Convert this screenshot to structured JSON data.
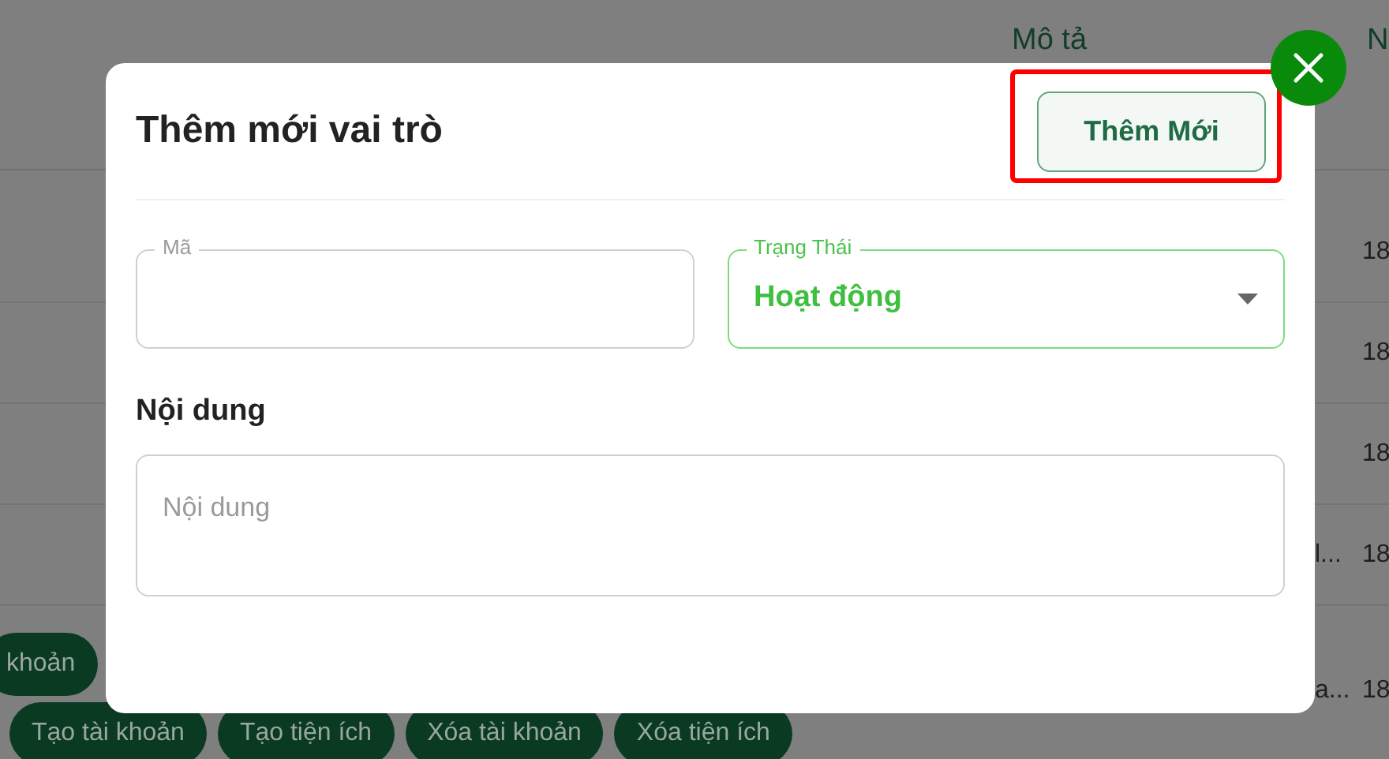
{
  "background_table": {
    "columns": [
      {
        "label": "Mô tả"
      },
      {
        "label": "N"
      }
    ],
    "rows": [
      {
        "column_1": "",
        "column_2": "18"
      },
      {
        "column_1": "",
        "column_2": "18"
      },
      {
        "column_1": "",
        "column_2": "18"
      },
      {
        "column_1": "l...",
        "column_2": "18"
      },
      {
        "column_1": "a...",
        "column_2": "18",
        "tag_rows": [
          [
            "khoản"
          ],
          [
            "Tạo tài khoản",
            "Tạo tiện ích",
            "Xóa tài khoản",
            "Xóa tiện ích"
          ]
        ]
      }
    ]
  },
  "dialog": {
    "title": "Thêm mới vai trò",
    "primary_button": "Thêm Mới",
    "highlighted": true,
    "fields": [
      {
        "kind": "text",
        "label": "Mã",
        "focused": false
      },
      {
        "kind": "select",
        "label": "Trạng Thái",
        "value": "Hoạt động",
        "focused": true
      }
    ],
    "content_label": "Nội dung",
    "content_placeholder": "Nội dung"
  }
}
